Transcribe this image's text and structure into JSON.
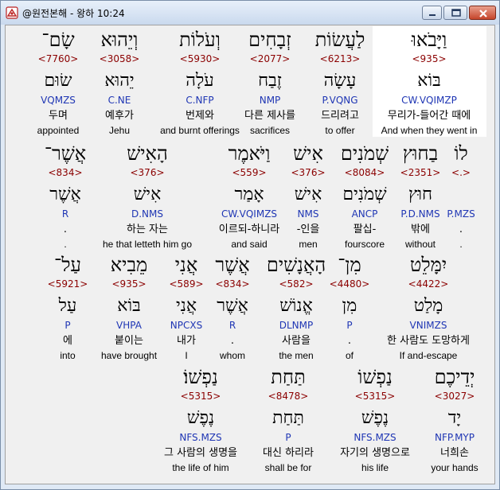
{
  "window": {
    "title": "@원전본해 - 왕하 10:24"
  },
  "rows": [
    {
      "words": [
        {
          "hebrew": "וַיָּבֹאוּ",
          "strong": "<935>",
          "lemma": "בּוֹא",
          "morph": "CW.VQIMZP",
          "korean": "무리가-들어간 때에",
          "english": "And when they went in",
          "selected": true
        },
        {
          "hebrew": "לַעֲשׂוֹת",
          "strong": "<6213>",
          "lemma": "עָשָׂה",
          "morph": "P.VQNG",
          "korean": "드리려고",
          "english": "to offer"
        },
        {
          "hebrew": "זְבָחִים",
          "strong": "<2077>",
          "lemma": "זֶבַח",
          "morph": "NMP",
          "korean": "다른 제사를",
          "english": "sacrifices"
        },
        {
          "hebrew": "וְעֹלוֹת",
          "strong": "<5930>",
          "lemma": "עֹלָה",
          "morph": "C.NFP",
          "korean": "번제와",
          "english": "and burnt offerings"
        },
        {
          "hebrew": "וְיֵהוּא",
          "strong": "<3058>",
          "lemma": "יֵהוּא",
          "morph": "C.NE",
          "korean": "예후가",
          "english": "Jehu"
        },
        {
          "hebrew": "שָׂם־",
          "strong": "<7760>",
          "lemma": "שׂוּם",
          "morph": "VQMZS",
          "korean": "두며",
          "english": "appointed"
        }
      ]
    },
    {
      "words": [
        {
          "hebrew": "לוֹ",
          "strong": "<.>",
          "lemma": "",
          "morph": "P.MZS",
          "korean": ".",
          "english": "."
        },
        {
          "hebrew": "בַחוּץ",
          "strong": "<2351>",
          "lemma": "חוּץ",
          "morph": "P.D.NMS",
          "korean": "밖에",
          "english": "without"
        },
        {
          "hebrew": "שְׁמֹנִים",
          "strong": "<8084>",
          "lemma": "שְׁמֹנִים",
          "morph": "ANCP",
          "korean": "팔십-",
          "english": "fourscore"
        },
        {
          "hebrew": "אִישׁ",
          "strong": "<376>",
          "lemma": "אִישׁ",
          "morph": "NMS",
          "korean": "-인을",
          "english": "men"
        },
        {
          "hebrew": "וַיֹּאמֶר",
          "strong": "<559>",
          "lemma": "אָמַר",
          "morph": "CW.VQIMZS",
          "korean": "이르되-하니라",
          "english": "and said"
        },
        {
          "hebrew": "הָאִישׁ",
          "strong": "<376>",
          "lemma": "אִישׁ",
          "morph": "D.NMS",
          "korean": "하는 자는",
          "english": "he that letteth him go"
        },
        {
          "hebrew": "אֲשֶׁר־",
          "strong": "<834>",
          "lemma": "אֲשֶׁר",
          "morph": "R",
          "korean": ".",
          "english": "."
        }
      ]
    },
    {
      "words": [
        {
          "hebrew": "יִמָּלֵט",
          "strong": "<4422>",
          "lemma": "מָלַט",
          "morph": "VNIMZS",
          "korean": "한 사람도 도망하게",
          "english": "If and-escape"
        },
        {
          "hebrew": "מִן־",
          "strong": "<4480>",
          "lemma": "מִן",
          "morph": "P",
          "korean": ".",
          "english": "of"
        },
        {
          "hebrew": "הָאֲנָשִׁים",
          "strong": "<582>",
          "lemma": "אֱנוֹשׁ",
          "morph": "DLNMP",
          "korean": "사람을",
          "english": "the men"
        },
        {
          "hebrew": "אֲשֶׁר",
          "strong": "<834>",
          "lemma": "אֲשֶׁר",
          "morph": "R",
          "korean": ".",
          "english": "whom"
        },
        {
          "hebrew": "אֲנִי",
          "strong": "<589>",
          "lemma": "אֲנִי",
          "morph": "NPCXS",
          "korean": "내가",
          "english": "I"
        },
        {
          "hebrew": "מֵבִיא",
          "strong": "<935>",
          "lemma": "בּוֹא",
          "morph": "VHPA",
          "korean": "붙이는",
          "english": "have brought"
        },
        {
          "hebrew": "עַל־",
          "strong": "<5921>",
          "lemma": "עַל",
          "morph": "P",
          "korean": "에",
          "english": "into"
        }
      ]
    },
    {
      "words": [
        {
          "hebrew": "יְדֵיכֶם",
          "strong": "<3027>",
          "lemma": "יָד",
          "morph": "NFP.MYP",
          "korean": "너희손",
          "english": "your hands"
        },
        {
          "hebrew": "נַפְשׁוֹ",
          "strong": "<5315>",
          "lemma": "נֶפֶשׁ",
          "morph": "NFS.MZS",
          "korean": "자기의 생명으로",
          "english": "his life"
        },
        {
          "hebrew": "תַּחַת",
          "strong": "<8478>",
          "lemma": "תַּחַת",
          "morph": "P",
          "korean": "대신 하리라",
          "english": "shall be for"
        },
        {
          "hebrew": "נַפְשׁוֹ׃",
          "strong": "<5315>",
          "lemma": "נֶפֶשׁ",
          "morph": "NFS.MZS",
          "korean": "그 사람의 생명을",
          "english": "the life of him"
        }
      ]
    }
  ]
}
